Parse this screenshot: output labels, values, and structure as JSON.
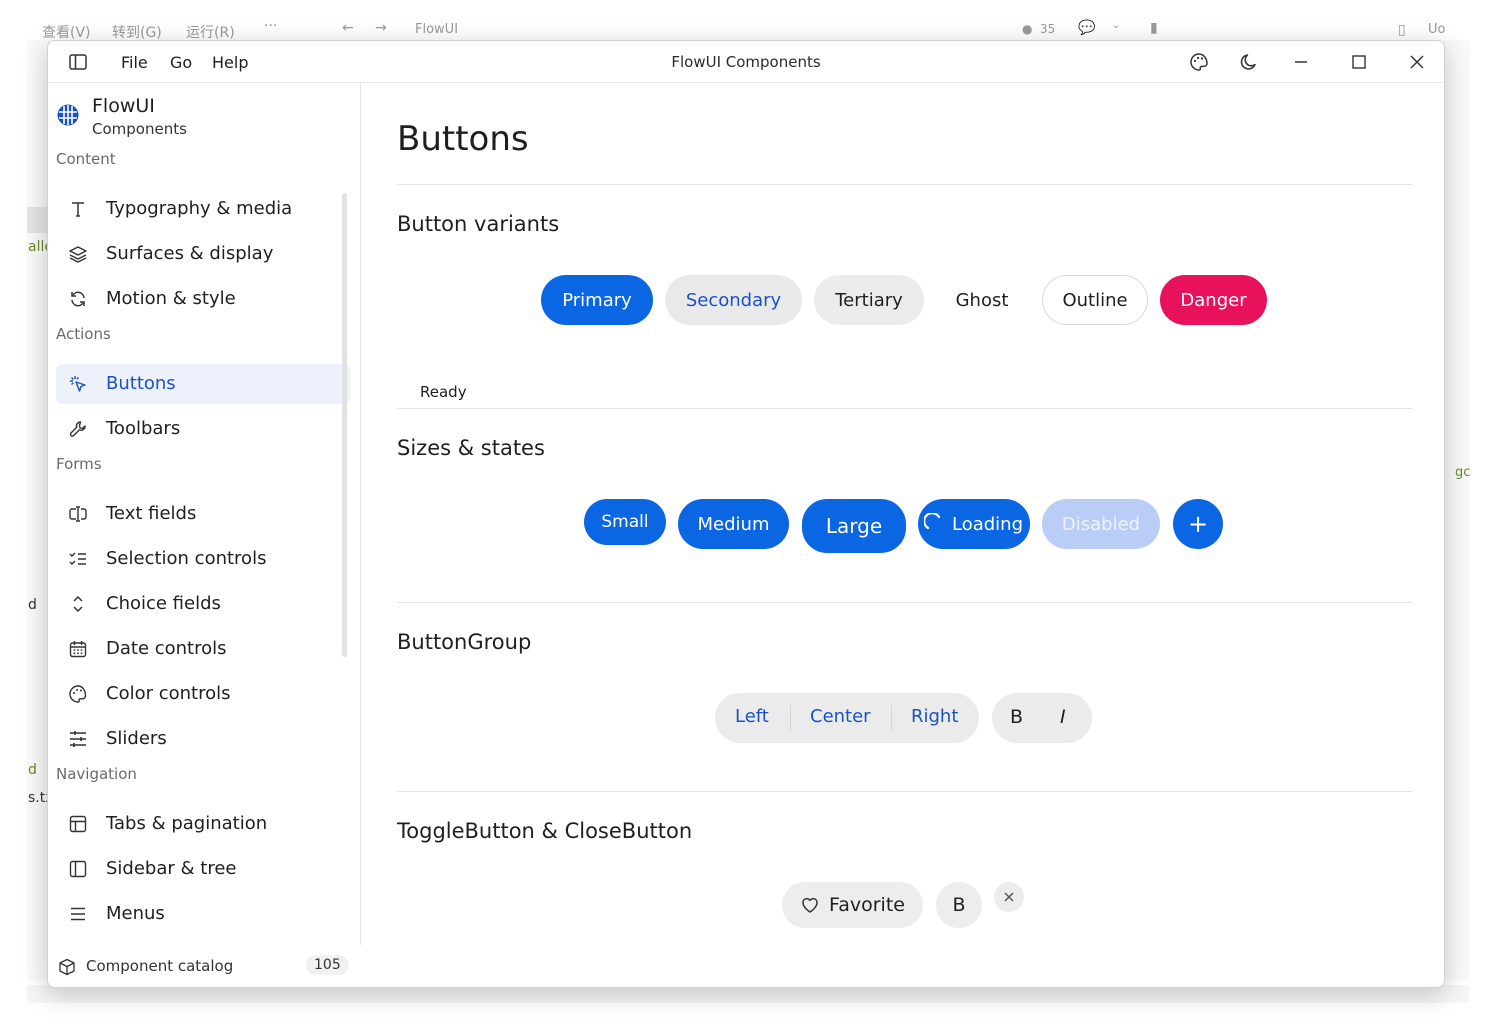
{
  "background_app": {
    "menu_view": "查看(V)",
    "menu_goto": "转到(G)",
    "menu_run": "运行(R)",
    "more": "···",
    "address": "FlowUI",
    "counter": "35",
    "left_fragments": [
      "alle",
      "d",
      "d",
      "s.tx"
    ],
    "right_fragment": "gc",
    "right_tab": "Uo"
  },
  "titlebar": {
    "menus": [
      "File",
      "Go",
      "Help"
    ],
    "title": "FlowUI Components",
    "icons": [
      "palette-icon",
      "moon-icon",
      "minimize-icon",
      "maximize-icon",
      "close-icon"
    ]
  },
  "sidebar": {
    "brand_name": "FlowUI",
    "brand_sub": "Components",
    "sections": [
      {
        "label": "Content",
        "items": [
          {
            "label": "Typography & media",
            "icon": "type-icon"
          },
          {
            "label": "Surfaces & display",
            "icon": "layers-icon"
          },
          {
            "label": "Motion & style",
            "icon": "refresh-icon"
          }
        ]
      },
      {
        "label": "Actions",
        "items": [
          {
            "label": "Buttons",
            "icon": "pointer-click-icon",
            "active": true
          },
          {
            "label": "Toolbars",
            "icon": "wrench-icon"
          }
        ]
      },
      {
        "label": "Forms",
        "items": [
          {
            "label": "Text fields",
            "icon": "text-cursor-icon"
          },
          {
            "label": "Selection controls",
            "icon": "checklist-icon"
          },
          {
            "label": "Choice fields",
            "icon": "chevrons-updown-icon"
          },
          {
            "label": "Date controls",
            "icon": "calendar-icon"
          },
          {
            "label": "Color controls",
            "icon": "palette-icon"
          },
          {
            "label": "Sliders",
            "icon": "sliders-icon"
          }
        ]
      },
      {
        "label": "Navigation",
        "items": [
          {
            "label": "Tabs & pagination",
            "icon": "layout-icon"
          },
          {
            "label": "Sidebar & tree",
            "icon": "sidebar-icon"
          },
          {
            "label": "Menus",
            "icon": "menu-icon"
          }
        ]
      }
    ],
    "footer_label": "Component catalog",
    "footer_count": "105"
  },
  "main": {
    "page_title": "Buttons",
    "variants": {
      "title": "Button variants",
      "buttons": [
        "Primary",
        "Secondary",
        "Tertiary",
        "Ghost",
        "Outline",
        "Danger"
      ],
      "status": "Ready"
    },
    "sizes": {
      "title": "Sizes & states",
      "buttons": [
        "Small",
        "Medium",
        "Large",
        "Loading",
        "Disabled",
        "+"
      ]
    },
    "group": {
      "title": "ButtonGroup",
      "segments": [
        "Left",
        "Center",
        "Right"
      ],
      "format": [
        "B",
        "I"
      ]
    },
    "toggle": {
      "title": "ToggleButton & CloseButton",
      "favorite": "Favorite",
      "bold": "B"
    }
  },
  "colors": {
    "primary": "#0b66e4",
    "danger": "#e8125c",
    "accent_text": "#1a52c5",
    "disabled": "#b9cdf7",
    "active_nav": "#edf1fb"
  }
}
